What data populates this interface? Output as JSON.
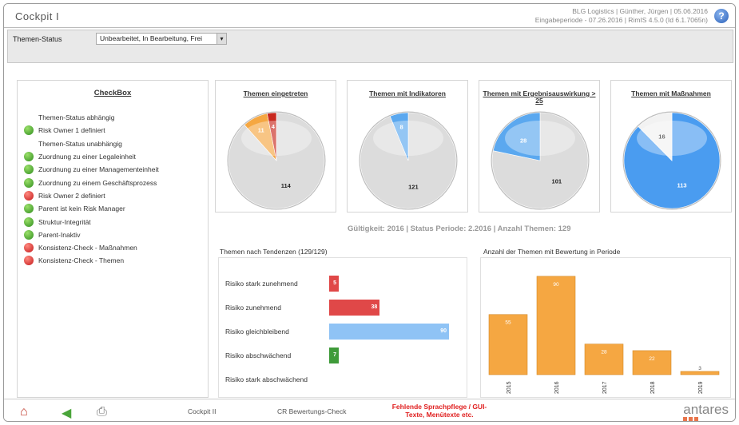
{
  "app": {
    "title": "Cockpit I",
    "meta_line1": "BLG Logistics | Günther, Jürgen | 05.06.2016",
    "meta_line2": "Eingabeperiode - 07.26.2016 | RimIS 4.5.0 (Id 6.1.7065n)"
  },
  "filter": {
    "label": "Themen-Status",
    "value": "Unbearbeitet, In Bearbeitung, Frei"
  },
  "checkbox": {
    "title": "CheckBox",
    "items": [
      {
        "label": "Themen-Status abhängig",
        "status": "none"
      },
      {
        "label": "Risk Owner 1 definiert",
        "status": "green"
      },
      {
        "label": "Themen-Status unabhängig",
        "status": "none"
      },
      {
        "label": "Zuordnung zu einer Legaleinheit",
        "status": "green"
      },
      {
        "label": "Zuordnung zu einer Managementeinheit",
        "status": "green"
      },
      {
        "label": "Zuordnung zu einem Geschäftsprozess",
        "status": "green"
      },
      {
        "label": "Risk Owner 2 definiert",
        "status": "red"
      },
      {
        "label": "Parent ist kein Risk Manager",
        "status": "green"
      },
      {
        "label": "Struktur-Integrität",
        "status": "green"
      },
      {
        "label": "Parent-Inaktiv",
        "status": "green"
      },
      {
        "label": "Konsistenz-Check - Maßnahmen",
        "status": "red"
      },
      {
        "label": "Konsistenz-Check - Themen",
        "status": "red"
      }
    ]
  },
  "pies": [
    {
      "title": "Themen eingetreten",
      "slices": [
        {
          "value": 114,
          "color": "#dcdcdc"
        },
        {
          "value": 11,
          "color": "#f5a742"
        },
        {
          "value": 4,
          "color": "#c8281e"
        }
      ]
    },
    {
      "title": "Themen mit Indikatoren",
      "slices": [
        {
          "value": 121,
          "color": "#dcdcdc"
        },
        {
          "value": 8,
          "color": "#5ba8ef"
        }
      ]
    },
    {
      "title": "Themen mit Ergebnisauswirkung > 25",
      "slices": [
        {
          "value": 101,
          "color": "#dcdcdc"
        },
        {
          "value": 28,
          "color": "#5ba8ef"
        }
      ]
    },
    {
      "title": "Themen mit Maßnahmen",
      "slices": [
        {
          "value": 113,
          "color": "#4a9cf0"
        },
        {
          "value": 16,
          "color": "#f2f2f2"
        }
      ]
    }
  ],
  "validity": "Gültigkeit: 2016 | Status Periode: 2.2016 | Anzahl Themen: 129",
  "trend": {
    "title": "Themen nach Tendenzen (129/129)",
    "rows": [
      {
        "label": "Risiko stark zunehmend",
        "value": 5,
        "color": "#e04848"
      },
      {
        "label": "Risiko zunehmend",
        "value": 38,
        "color": "#e04848"
      },
      {
        "label": "Risiko gleichbleibend",
        "value": 90,
        "color": "#8fc3f5"
      },
      {
        "label": "Risiko abschwächend",
        "value": 7,
        "color": "#3f9b3a"
      },
      {
        "label": "Risiko stark abschwächend",
        "value": null,
        "color": "#3f9b3a"
      }
    ],
    "max": 90
  },
  "chart_data": {
    "type": "bar",
    "title": "Anzahl der Themen mit Bewertung in Periode",
    "categories": [
      "2015",
      "2016",
      "2017",
      "2018",
      "2019"
    ],
    "values": [
      55,
      90,
      28,
      22,
      3
    ],
    "ylim": [
      0,
      95
    ],
    "color": "#f5a742"
  },
  "footer": {
    "link1": "Cockpit II",
    "link2": "CR Bewertungs-Check",
    "warning_line1": "Fehlende Sprachpflege / GUI-",
    "warning_line2": "Texte, Menütexte etc.",
    "logo": "antares"
  }
}
